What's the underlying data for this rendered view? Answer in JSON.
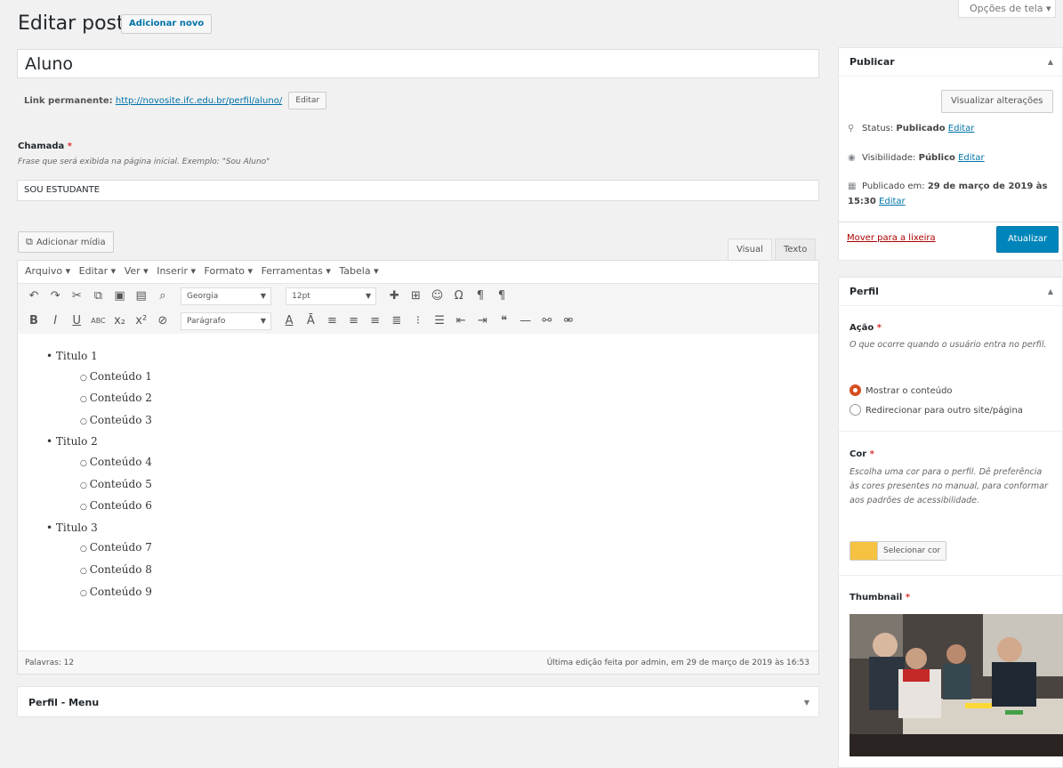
{
  "header": {
    "screen_options": "Opções de tela ▾",
    "title": "Editar post",
    "add_new": "Adicionar novo"
  },
  "post": {
    "title": "Aluno",
    "permalink_label": "Link permanente:",
    "permalink_url": "http://novosite.ifc.edu.br/perfil/aluno/",
    "permalink_edit": "Editar"
  },
  "chamada": {
    "label": "Chamada",
    "required": "*",
    "description": "Frase que será exibida na página inicial. Exemplo: \"Sou Aluno\"",
    "value": "SOU ESTUDANTE"
  },
  "editor": {
    "add_media": "Adicionar mídia",
    "tab_visual": "Visual",
    "tab_text": "Texto",
    "menus": [
      "Arquivo ▾",
      "Editar ▾",
      "Ver ▾",
      "Inserir ▾",
      "Formato ▾",
      "Ferramentas ▾",
      "Tabela ▾"
    ],
    "font_family": "Georgia",
    "font_size": "12pt",
    "format": "Parágrafo",
    "content": [
      {
        "title": "Titulo 1",
        "items": [
          "Conteúdo 1",
          "Conteúdo 2",
          "Conteúdo 3"
        ]
      },
      {
        "title": "Titulo 2",
        "items": [
          "Conteúdo 4",
          "Conteúdo 5",
          "Conteúdo 6"
        ]
      },
      {
        "title": "Titulo 3",
        "items": [
          "Conteúdo 7",
          "Conteúdo 8",
          "Conteúdo 9"
        ]
      }
    ],
    "word_count": "Palavras: 12",
    "last_edit": "Última edição feita por admin, em 29 de março de 2019 às 16:53"
  },
  "perfil_menu": {
    "title": "Perfil - Menu"
  },
  "publish": {
    "title": "Publicar",
    "preview": "Visualizar alterações",
    "status_label": "Status:",
    "status_value": "Publicado",
    "visibility_label": "Visibilidade:",
    "visibility_value": "Público",
    "published_label": "Publicado em:",
    "published_value": "29 de março de 2019 às",
    "published_time": "15:30",
    "edit": "Editar",
    "trash": "Mover para a lixeira",
    "update": "Atualizar"
  },
  "perfil": {
    "title": "Perfil",
    "acao_label": "Ação",
    "acao_desc": "O que ocorre quando o usuário entra no perfil.",
    "option1": "Mostrar o conteúdo",
    "option2": "Redirecionar para outro site/página",
    "cor_label": "Cor",
    "cor_desc": "Escolha uma cor para o perfil. Dê preferência às cores presentes no manual, para conformar aos padrões de acessibilidade.",
    "cor_button": "Selecionar cor",
    "cor_value": "#f5c242",
    "thumb_label": "Thumbnail"
  }
}
